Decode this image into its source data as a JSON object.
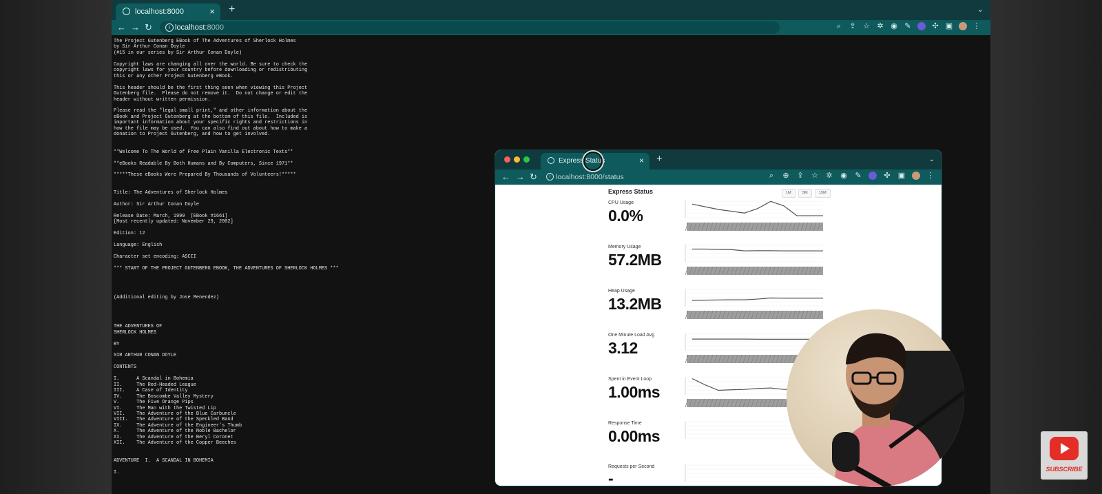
{
  "main_browser": {
    "tab_title": "localhost:8000",
    "url_host": "localhost",
    "url_rest": ":8000"
  },
  "ebook_text": "The Project Gutenberg EBook of The Adventures of Sherlock Holmes\nby Sir Arthur Conan Doyle\n(#15 in our series by Sir Arthur Conan Doyle)\n\nCopyright laws are changing all over the world. Be sure to check the\ncopyright laws for your country before downloading or redistributing\nthis or any other Project Gutenberg eBook.\n\nThis header should be the first thing seen when viewing this Project\nGutenberg file.  Please do not remove it.  Do not change or edit the\nheader without written permission.\n\nPlease read the \"legal small print,\" and other information about the\neBook and Project Gutenberg at the bottom of this file.  Included is\nimportant information about your specific rights and restrictions in\nhow the file may be used.  You can also find out about how to make a\ndonation to Project Gutenberg, and how to get involved.\n\n\n**Welcome To The World of Free Plain Vanilla Electronic Texts**\n\n**eBooks Readable By Both Humans and By Computers, Since 1971**\n\n*****These eBooks Were Prepared By Thousands of Volunteers!*****\n\n\nTitle: The Adventures of Sherlock Holmes\n\nAuthor: Sir Arthur Conan Doyle\n\nRelease Date: March, 1999  [EBook #1661]\n[Most recently updated: November 29, 2002]\n\nEdition: 12\n\nLanguage: English\n\nCharacter set encoding: ASCII\n\n*** START OF THE PROJECT GUTENBERG EBOOK, THE ADVENTURES OF SHERLOCK HOLMES ***\n\n\n\n\n(Additional editing by Jose Menendez)\n\n\n\n\nTHE ADVENTURES OF\nSHERLOCK HOLMES\n\nBY\n\nSIR ARTHUR CONAN DOYLE\n\nCONTENTS\n\nI.      A Scandal in Bohemia\nII.     The Red-Headed League\nIII.    A Case of Identity\nIV.     The Boscombe Valley Mystery\nV.      The Five Orange Pips\nVI.     The Man with the Twisted Lip\nVII.    The Adventure of the Blue Carbuncle\nVIII.   The Adventure of the Speckled Band\nIX.     The Adventure of the Engineer's Thumb\nX.      The Adventure of the Noble Bachelor\nXI.     The Adventure of the Beryl Coronet\nXII.    The Adventure of the Copper Beeches\n\n\nADVENTURE  I.  A SCANDAL IN BOHEMIA\n\nI.",
  "status_browser": {
    "tab_title": "Express Status",
    "url_host": "localhost",
    "url_rest": ":8000/status"
  },
  "status_page": {
    "title": "Express Status",
    "ranges": [
      "1M",
      "5M",
      "15M"
    ],
    "metrics": [
      {
        "label": "CPU Usage",
        "value": "0.0%"
      },
      {
        "label": "Memory Usage",
        "value": "57.2MB"
      },
      {
        "label": "Heap Usage",
        "value": "13.2MB"
      },
      {
        "label": "One Minute Load Avg",
        "value": "3.12"
      },
      {
        "label": "Spent in Event Loop",
        "value": "1.00ms"
      },
      {
        "label": "Response Time",
        "value": "0.00ms"
      },
      {
        "label": "Requests per Second",
        "value": "-"
      }
    ]
  },
  "youtube": {
    "label": "SUBSCRIBE"
  },
  "colors": {
    "accent": "#0e5a5c",
    "tabbar": "#103a3d",
    "youtube_red": "#e52d27"
  }
}
